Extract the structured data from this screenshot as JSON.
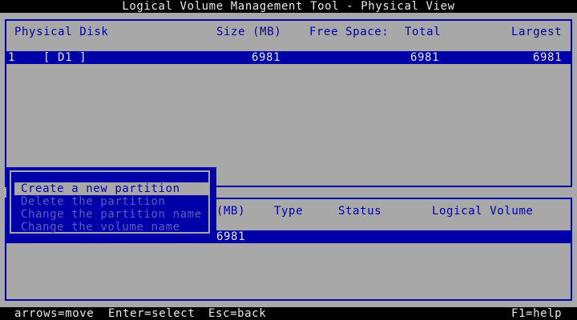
{
  "title": "Logical Volume Management Tool - Physical View",
  "disks_panel": {
    "headers": {
      "disk": "Physical Disk",
      "size": "Size (MB)",
      "free": "Free Space:",
      "total": "Total",
      "largest": "Largest"
    },
    "rows": [
      {
        "num": "1",
        "name": "[ D1 ]",
        "size": "6981",
        "total": "6981",
        "largest": "6981"
      }
    ]
  },
  "partitions_panel": {
    "headers": {
      "size_tail": "(MB)",
      "type": "Type",
      "status": "Status",
      "volume": "Logical Volume"
    },
    "rows": [
      {
        "size": "6981"
      }
    ]
  },
  "menu": {
    "items": [
      {
        "label": "Create a new partition",
        "state": "selected"
      },
      {
        "label": "Delete the partition",
        "state": "disabled"
      },
      {
        "label": "Change the partition name",
        "state": "disabled"
      },
      {
        "label": "Change the volume name",
        "state": "disabled"
      }
    ]
  },
  "statusbar": {
    "move": "arrows=move",
    "select": "Enter=select",
    "back": "Esc=back",
    "help": "F1=help"
  },
  "colors": {
    "background": "#a8a8a8",
    "panel_blue": "#0000a8",
    "bar_black": "#000000",
    "text_light": "#e8e8e8"
  }
}
